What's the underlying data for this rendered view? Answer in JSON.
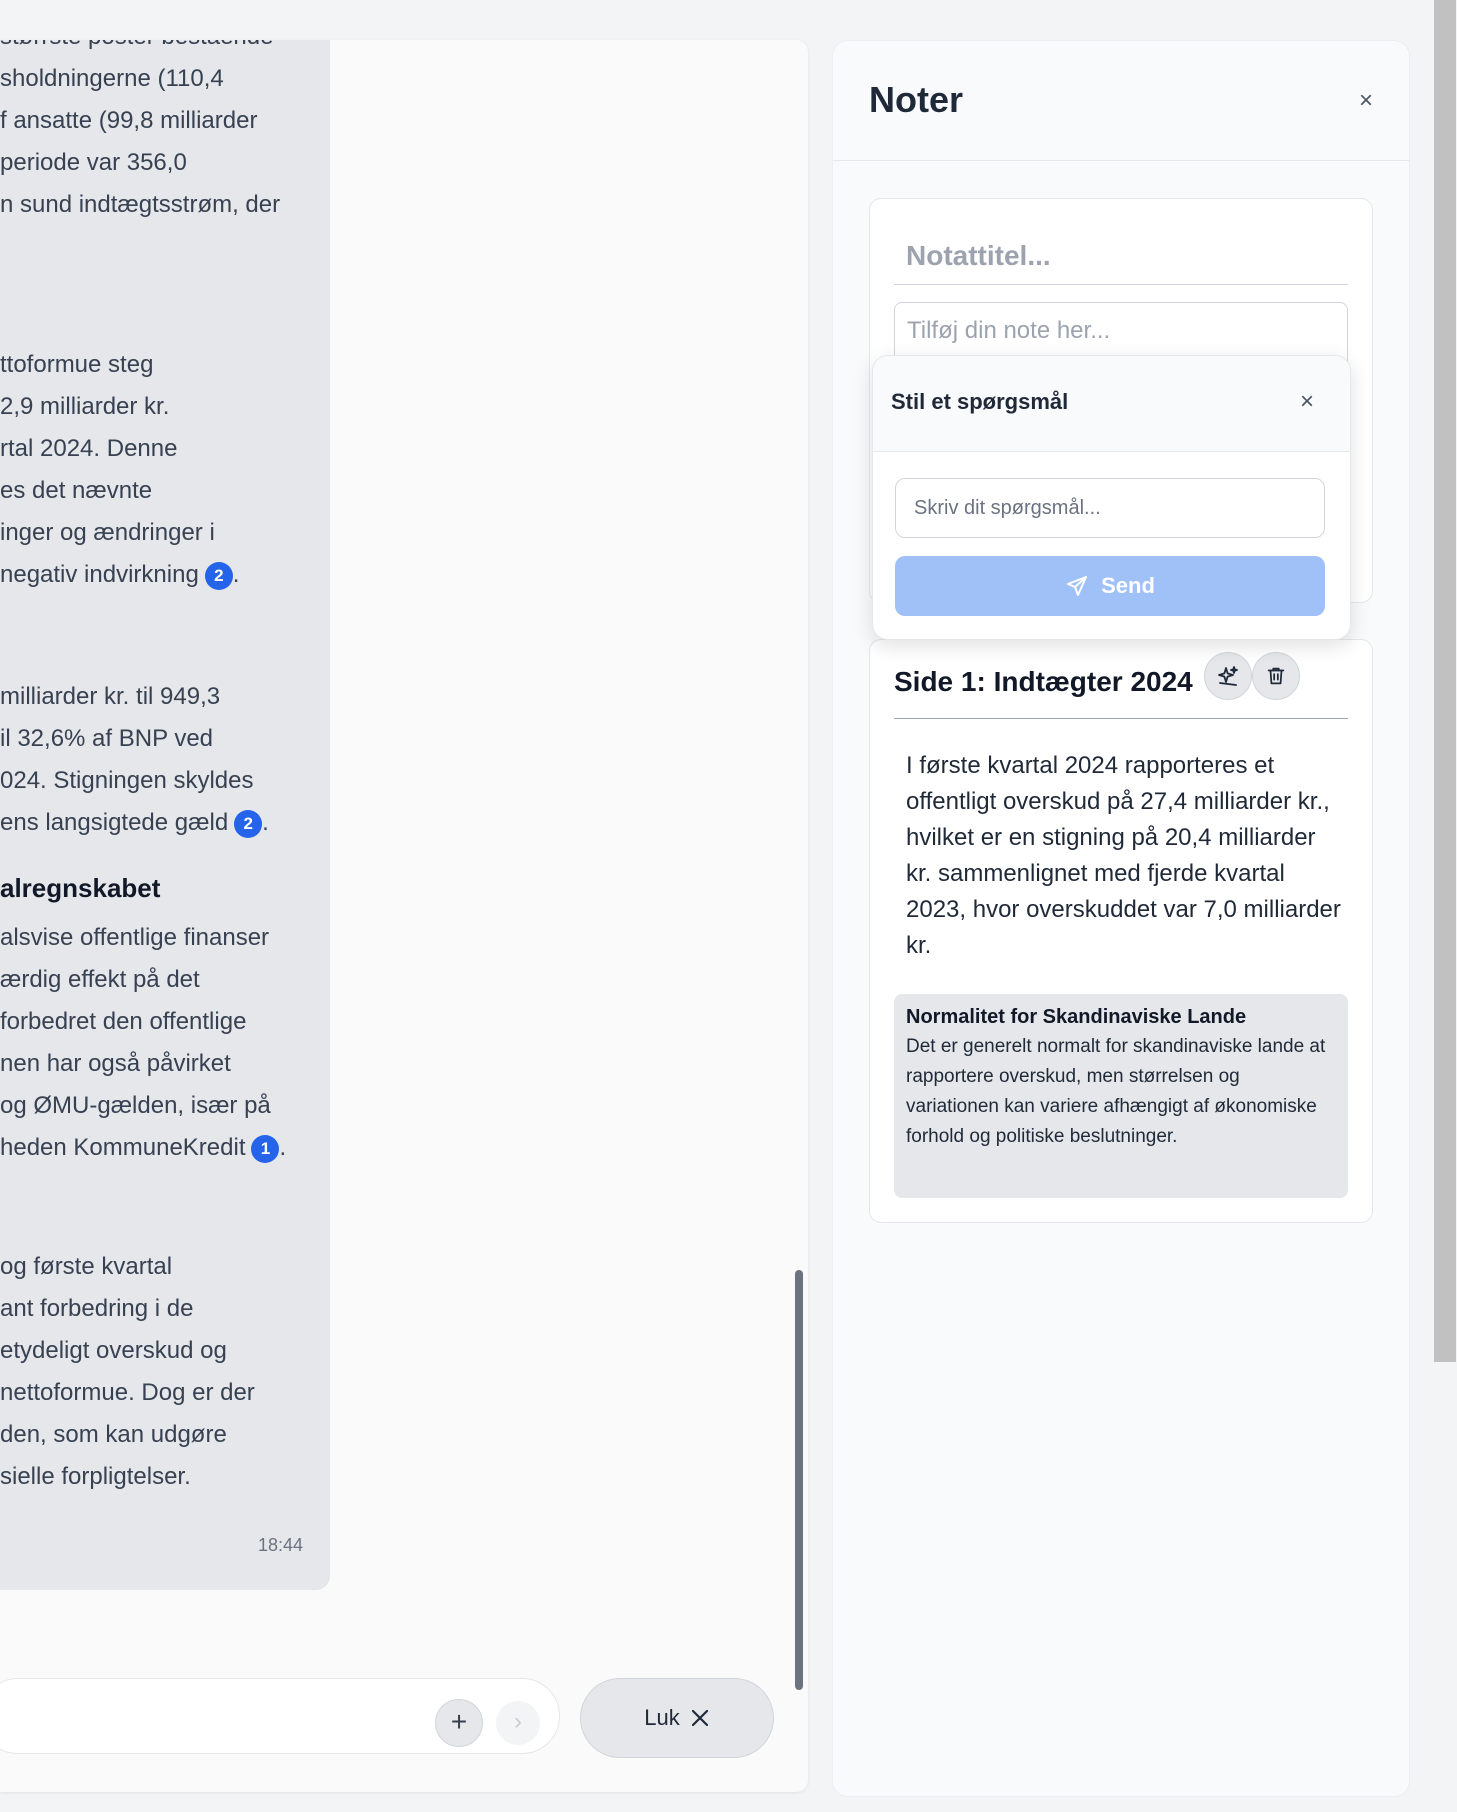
{
  "chat": {
    "lines": [
      "størrste poster bestående",
      "sholdningerne (110,4",
      "f ansatte (99,8 milliarder",
      " periode var 356,0",
      "n sund indtægtsstrøm, der",
      "ttoformue steg",
      "2,9 milliarder kr.",
      "rtal 2024. Denne",
      "es det nævnte",
      "inger og ændringer i",
      "negativ indvirkning",
      "milliarder kr. til 949,3",
      "il 32,6% af BNP ved",
      "024. Stigningen skyldes",
      "ens langsigtede gæld",
      "alregnskabet",
      "alsvise offentlige finanser",
      "ærdig effekt på det",
      "forbedret den offentlige",
      "nen har også påvirket",
      "og ØMU-gælden, især på",
      "heden KommuneKredit",
      "og første kvartal",
      "ant forbedring i de",
      "etydeligt overskud og",
      "nettoformue. Dog er der",
      "den, som kan udgøre",
      "sielle forpligtelser."
    ],
    "citations": [
      "2",
      "2",
      "1"
    ],
    "timestamp": "18:44",
    "close_label": "Luk",
    "plus_label": "+",
    "next_label": "›"
  },
  "notes": {
    "title": "Noter",
    "close_symbol": "×",
    "new_note": {
      "title_placeholder": "Notattitel...",
      "body_placeholder": "Tilføj din note her..."
    },
    "question_popup": {
      "title": "Stil et spørgsmål",
      "close_symbol": "×",
      "input_placeholder": "Skriv dit spørgsmål...",
      "send_label": "Send"
    },
    "saved_note": {
      "title": "Side 1: Indtægter 2024",
      "body": "I første kvartal 2024 rapporteres et offentligt overskud på 27,4 milliarder kr., hvilket er en stigning på 20,4 milliarder kr. sammenlignet med fjerde kvartal 2023, hvor overskuddet var 7,0 milliarder kr.",
      "annotation_title": "Normalitet for Skandinaviske Lande",
      "annotation_body": "Det er generelt normalt for skandinaviske lande at rapportere overskud, men størrelsen og variationen kan variere afhængigt af økonomiske forhold og politiske beslutninger."
    }
  },
  "colors": {
    "citation": "#2563eb",
    "send_button": "#a0c0f8"
  },
  "icons": [
    "send-icon",
    "sparkle-icon",
    "trash-icon",
    "close-icon",
    "plus-icon",
    "chevron-right-icon"
  ]
}
